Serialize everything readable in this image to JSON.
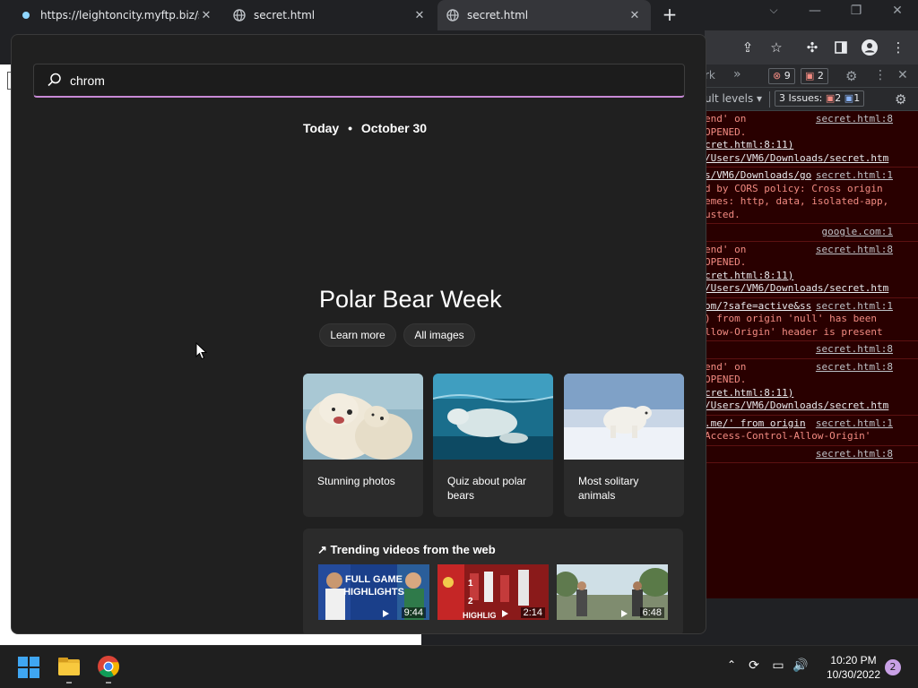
{
  "browser": {
    "tabs": [
      {
        "title": "https://leightoncity.myftp.biz/sec",
        "active": false
      },
      {
        "title": "secret.html",
        "active": false
      },
      {
        "title": "secret.html",
        "active": true
      }
    ],
    "new_tab_label": "+",
    "window_controls": {
      "minimize": "—",
      "restore": "❐",
      "close": "✕"
    }
  },
  "toolbar": {
    "icons": [
      "share-icon",
      "star-icon",
      "puzzle-icon",
      "sidepanel-icon",
      "profile-icon",
      "menu-icon"
    ]
  },
  "devtools": {
    "tab_partial": "rk",
    "more_tabs": "»",
    "error_count": "9",
    "warning_count": "2",
    "levels_partial": "ult levels ▾",
    "issues_label": "3 Issues:",
    "issues_errors": "2",
    "issues_info": "1",
    "entries": [
      {
        "lines": [
          {
            "text": "end' on",
            "source": "secret.html:8"
          },
          {
            "text": " OPENED.",
            "source": ""
          },
          {
            "text": "cret.html:8:11)",
            "source": "",
            "link": true
          },
          {
            "text": "/Users/VM6/Downloads/secret.htm",
            "source": "",
            "link": true
          }
        ]
      },
      {
        "lines": [
          {
            "text": "s/VM6/Downloads/go",
            "source": "secret.html:1",
            "link": true
          },
          {
            "text": "d by CORS policy: Cross origin",
            "source": ""
          },
          {
            "text": "emes: http, data, isolated-app,",
            "source": ""
          },
          {
            "text": "usted.",
            "source": ""
          }
        ]
      },
      {
        "lines": [
          {
            "text": "",
            "source": "google.com:1"
          }
        ]
      },
      {
        "lines": [
          {
            "text": "end' on",
            "source": "secret.html:8"
          },
          {
            "text": " OPENED.",
            "source": ""
          },
          {
            "text": "cret.html:8:11)",
            "source": "",
            "link": true
          },
          {
            "text": "/Users/VM6/Downloads/secret.htm",
            "source": "",
            "link": true
          }
        ]
      },
      {
        "lines": [
          {
            "text": "om/?safe=active&ss",
            "source": "secret.html:1",
            "link": true
          },
          {
            "text": ") from origin 'null' has been",
            "source": ""
          },
          {
            "text": "llow-Origin' header is present",
            "source": ""
          }
        ]
      },
      {
        "lines": [
          {
            "text": "",
            "source": "secret.html:8"
          }
        ]
      },
      {
        "lines": [
          {
            "text": "end' on",
            "source": "secret.html:8"
          },
          {
            "text": " OPENED.",
            "source": ""
          },
          {
            "text": "cret.html:8:11)",
            "source": "",
            "link": true
          },
          {
            "text": "/Users/VM6/Downloads/secret.htm",
            "source": "",
            "link": true
          }
        ]
      },
      {
        "lines": [
          {
            "text": ".me/' from origin",
            "source": "secret.html:1",
            "link": true
          },
          {
            "text": "Access-Control-Allow-Origin'",
            "source": ""
          }
        ]
      },
      {
        "lines": [
          {
            "text": "",
            "source": "secret.html:8"
          }
        ]
      }
    ]
  },
  "start_menu": {
    "search_value": "chrom",
    "date_prefix": "Today",
    "date_sep": "•",
    "date_value": "October 30",
    "headline": "Polar Bear Week",
    "buttons": {
      "learn_more": "Learn more",
      "all_images": "All images"
    },
    "cards": [
      {
        "caption": "Stunning photos"
      },
      {
        "caption": "Quiz about polar bears"
      },
      {
        "caption": "Most solitary animals"
      }
    ],
    "trending_title": "Trending videos from the web",
    "videos": [
      {
        "duration": "9:44",
        "overlay": "FULL GAME HIGHLIGHTS"
      },
      {
        "duration": "2:14",
        "overlay": "HIGHLIG"
      },
      {
        "duration": "6:48",
        "overlay": ""
      }
    ]
  },
  "taskbar": {
    "time": "10:20 PM",
    "date": "10/30/2022",
    "notifications": "2"
  }
}
